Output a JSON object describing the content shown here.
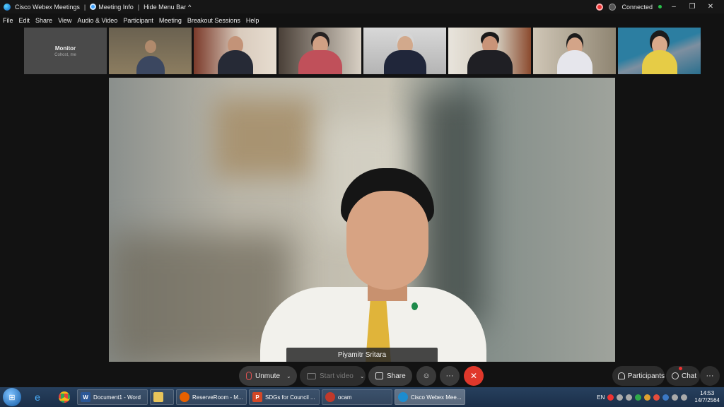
{
  "titlebar": {
    "app_title": "Cisco Webex Meetings",
    "meeting_info": "Meeting Info",
    "hide_menu_bar": "Hide Menu Bar",
    "status": "Connected"
  },
  "menu": [
    "File",
    "Edit",
    "Share",
    "View",
    "Audio & Video",
    "Participant",
    "Meeting",
    "Breakout Sessions",
    "Help"
  ],
  "thumbnails": {
    "monitor_title": "Monitor",
    "monitor_sub": "Cohost, me"
  },
  "main_video": {
    "speaker_name": "Piyamitr Sritara"
  },
  "controls": {
    "unmute": "Unmute",
    "start_video": "Start video",
    "share": "Share",
    "participants": "Participants",
    "chat": "Chat"
  },
  "taskbar": {
    "items": [
      {
        "label": "Document1 - Word"
      },
      {
        "label": ""
      },
      {
        "label": "ReserveRoom - M..."
      },
      {
        "label": "SDGs for Council ..."
      },
      {
        "label": "ocam"
      },
      {
        "label": "Cisco Webex Mee..."
      }
    ],
    "lang": "EN",
    "time": "14:53",
    "date": "14/7/2564"
  },
  "colors": {
    "end_button": "#e0382b",
    "connected": "#29c24a",
    "taskbar": "#1b2f49"
  }
}
